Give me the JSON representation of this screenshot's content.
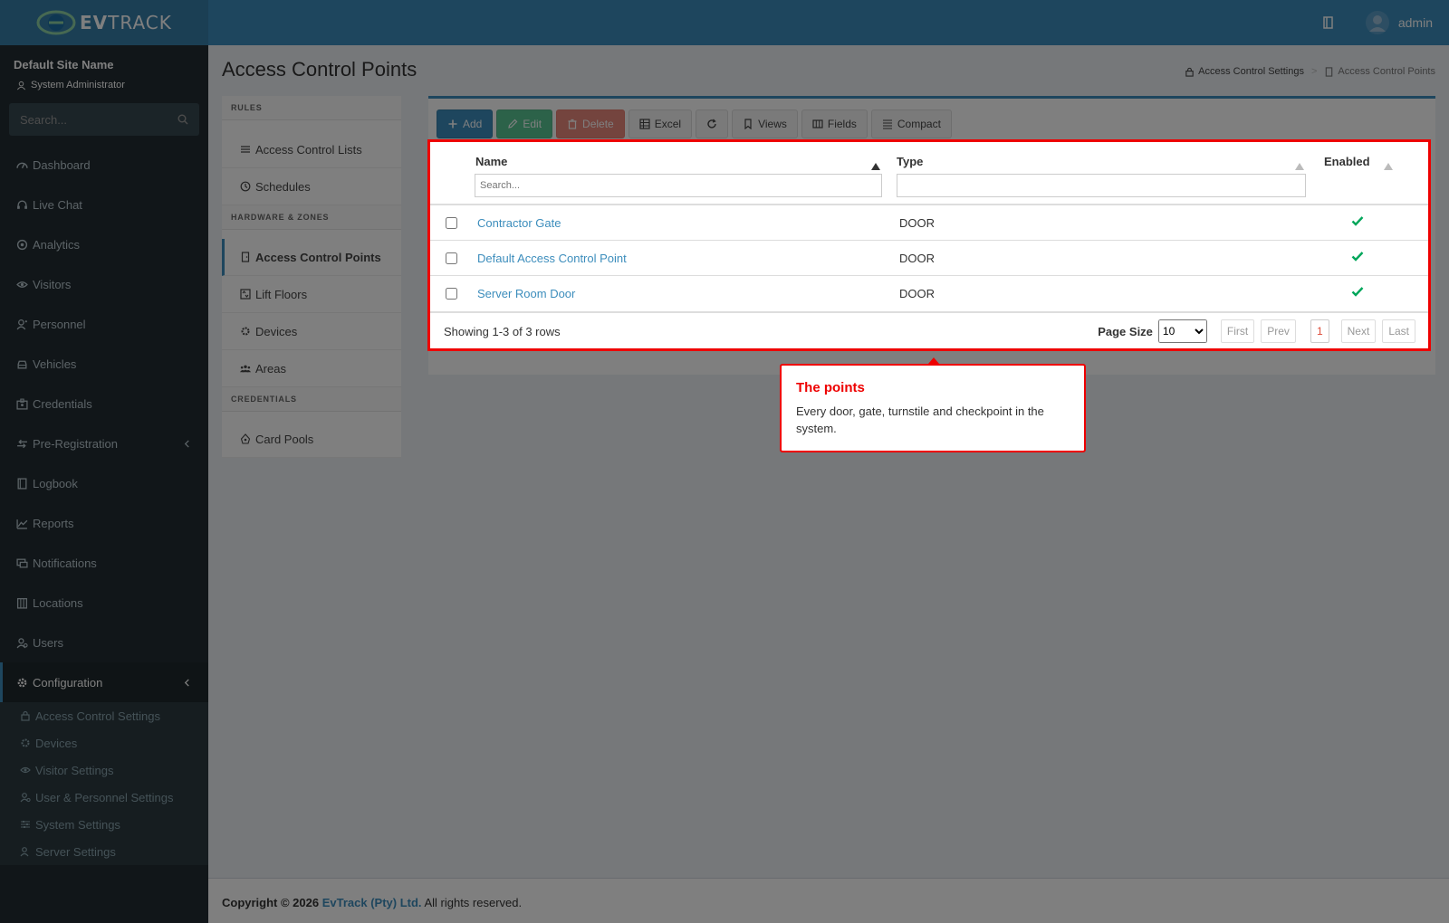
{
  "header": {
    "logo_bold": "EV",
    "logo_rest": "TRACK",
    "user_name": "admin"
  },
  "sidebar": {
    "site_name": "Default Site Name",
    "role": "System Administrator",
    "search_placeholder": "Search...",
    "items": [
      {
        "label": "Dashboard",
        "icon": "dashboard-icon"
      },
      {
        "label": "Live Chat",
        "icon": "headset-icon"
      },
      {
        "label": "Analytics",
        "icon": "target-icon"
      },
      {
        "label": "Visitors",
        "icon": "eye-icon"
      },
      {
        "label": "Personnel",
        "icon": "user-tie-icon"
      },
      {
        "label": "Vehicles",
        "icon": "car-icon"
      },
      {
        "label": "Credentials",
        "icon": "id-card-icon"
      },
      {
        "label": "Pre-Registration",
        "icon": "arrows-icon"
      },
      {
        "label": "Logbook",
        "icon": "book-icon"
      },
      {
        "label": "Reports",
        "icon": "chart-icon"
      },
      {
        "label": "Notifications",
        "icon": "bell-icon"
      },
      {
        "label": "Locations",
        "icon": "building-icon"
      },
      {
        "label": "Users",
        "icon": "users-icon"
      },
      {
        "label": "Configuration",
        "icon": "gear-icon"
      }
    ],
    "subitems": [
      {
        "label": "Access Control Settings",
        "icon": "lock-icon"
      },
      {
        "label": "Devices",
        "icon": "cog-icon"
      },
      {
        "label": "Visitor Settings",
        "icon": "eye-icon"
      },
      {
        "label": "User & Personnel Settings",
        "icon": "user-cog-icon"
      },
      {
        "label": "System Settings",
        "icon": "sliders-icon"
      },
      {
        "label": "Server Settings",
        "icon": "server-icon"
      }
    ]
  },
  "page": {
    "title": "Access Control Points",
    "breadcrumb": [
      "Access Control Settings",
      "Access Control Points"
    ]
  },
  "rules_panel": {
    "sections": [
      {
        "head": "RULES",
        "items": [
          "Access Control Lists",
          "Schedules"
        ]
      },
      {
        "head": "HARDWARE & ZONES",
        "items": [
          "Access Control Points",
          "Lift Floors",
          "Devices",
          "Areas"
        ]
      },
      {
        "head": "CREDENTIALS",
        "items": [
          "Card Pools"
        ]
      }
    ]
  },
  "toolbar": {
    "add": "Add",
    "edit": "Edit",
    "delete": "Delete",
    "excel": "Excel",
    "views": "Views",
    "fields": "Fields",
    "compact": "Compact"
  },
  "table": {
    "columns": [
      "Name",
      "Type",
      "Enabled"
    ],
    "name_filter_placeholder": "Search...",
    "rows": [
      {
        "name": "Contractor Gate",
        "type": "DOOR",
        "enabled": true
      },
      {
        "name": "Default Access Control Point",
        "type": "DOOR",
        "enabled": true
      },
      {
        "name": "Server Room Door",
        "type": "DOOR",
        "enabled": true
      }
    ],
    "showing": "Showing 1-3 of 3 rows",
    "page_size_label": "Page Size",
    "page_size": "10",
    "pager": {
      "first": "First",
      "prev": "Prev",
      "current": "1",
      "next": "Next",
      "last": "Last"
    }
  },
  "tooltip": {
    "title": "The points",
    "body": "Every door, gate, turnstile and checkpoint in the system."
  },
  "footer": {
    "prefix": "Copyright © 2026",
    "company": "EvTrack (Pty) Ltd.",
    "suffix": "All rights reserved."
  },
  "colors": {
    "accent": "#3c8dbc",
    "sidebar": "#222d32",
    "highlight": "#e00000",
    "enabled": "#00a65a"
  }
}
